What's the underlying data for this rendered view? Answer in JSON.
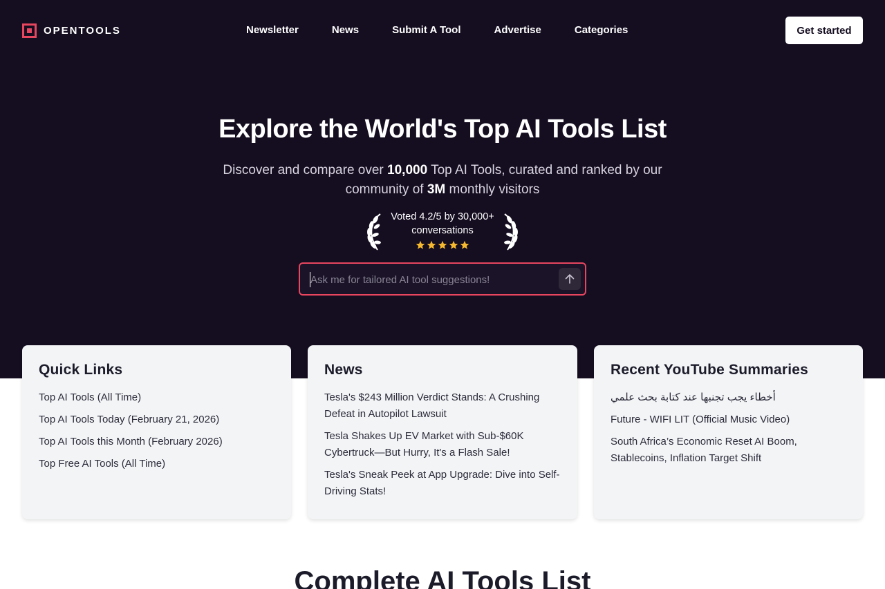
{
  "brand": {
    "name": "OPENTOOLS",
    "accent": "#e8465f",
    "bg": "#150d20"
  },
  "nav": {
    "links": [
      "Newsletter",
      "News",
      "Submit A Tool",
      "Advertise",
      "Categories"
    ],
    "cta": "Get started"
  },
  "hero": {
    "title": "Explore the World's Top AI Tools List",
    "sub_1": "Discover and compare over ",
    "sub_count": "10,000",
    "sub_2": " Top AI Tools, curated and ranked by our community of ",
    "sub_visitors": "3M",
    "sub_3": " monthly visitors",
    "rating_text": "Voted 4.2/5 by 30,000+ conversations",
    "stars": 5,
    "search_placeholder": "Ask me for tailored AI tool suggestions!"
  },
  "cards": {
    "quick_links": {
      "title": "Quick Links",
      "items": [
        "Top AI Tools (All Time)",
        "Top AI Tools Today (February 21, 2026)",
        "Top AI Tools this Month (February 2026)",
        "Top Free AI Tools (All Time)"
      ]
    },
    "news": {
      "title": "News",
      "items": [
        "Tesla's $243 Million Verdict Stands: A Crushing Defeat in Autopilot Lawsuit",
        "Tesla Shakes Up EV Market with Sub-$60K Cybertruck—But Hurry, It's a Flash Sale!",
        "Tesla's Sneak Peek at App Upgrade: Dive into Self-Driving Stats!"
      ]
    },
    "youtube": {
      "title": "Recent YouTube Summaries",
      "items": [
        "أخطاء يجب تجنبها عند كتابة بحث علمي",
        "Future - WIFI LIT (Official Music Video)",
        "South Africa’s Economic Reset AI Boom, Stablecoins, Inflation Target Shift"
      ]
    }
  },
  "section": {
    "title": "Complete AI Tools List"
  }
}
